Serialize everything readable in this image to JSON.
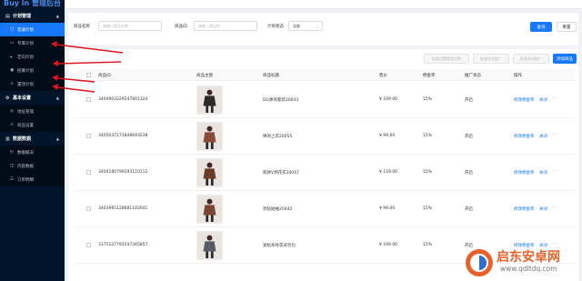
{
  "app": {
    "logo_text": "Buy in 管理后台"
  },
  "sidebar": {
    "groups": [
      {
        "label": "计划管理",
        "items": [
          {
            "label": "普通计划"
          },
          {
            "label": "专属计划"
          },
          {
            "label": "定向计划"
          },
          {
            "label": "招募计划"
          },
          {
            "label": "置顶计划"
          }
        ]
      },
      {
        "label": "基本设置",
        "items": [
          {
            "label": "地址管理"
          },
          {
            "label": "商品设置"
          }
        ]
      },
      {
        "label": "数据数据",
        "items": [
          {
            "label": "数据概况"
          },
          {
            "label": "内容数据"
          },
          {
            "label": "订单明细"
          }
        ]
      }
    ]
  },
  "filters": {
    "name_label": "商品名称",
    "name_placeholder": "请输入商品名称",
    "id_label": "商品ID",
    "id_placeholder": "请输入商品ID",
    "status_label": "计划状态",
    "status_value": "全部",
    "search_button": "查询",
    "reset_button": "重置"
  },
  "toolbar": {
    "batch_commission": "批量设置佣金比例",
    "batch_open": "批量开启推广",
    "batch_close": "批量关闭推广",
    "add_product": "添加商品"
  },
  "table": {
    "headers": [
      "商品ID",
      "商品主图",
      "商品标题",
      "售价",
      "佣金率",
      "推广状态",
      "操作"
    ],
    "rows": [
      {
        "id": "3404903329247801324",
        "title": "DG休闲套装20043",
        "price": "¥ 109.00",
        "rate": "15%",
        "status": "开启",
        "op1": "修改佣金率",
        "op2": "关闭",
        "more": "···",
        "thumb_color": "#2b2b2b"
      },
      {
        "id": "3405037271848693238",
        "title": "休闲上衣20055",
        "price": "¥ 99.00",
        "rate": "15%",
        "status": "开启",
        "op1": "修改佣金率",
        "op2": "关闭",
        "more": "···",
        "thumb_color": "#8a4a3a"
      },
      {
        "id": "3404180799293110112",
        "title": "新款V领花衣20047",
        "price": "¥ 119.00",
        "rate": "15%",
        "status": "开启",
        "op1": "修改佣金率",
        "op2": "关闭",
        "more": "···",
        "thumb_color": "#6b3a2b"
      },
      {
        "id": "3403965128681102041",
        "title": "亮钻短袖20042",
        "price": "¥ 99.00",
        "rate": "15%",
        "status": "开启",
        "op1": "修改佣金率",
        "op2": "关闭",
        "more": "···",
        "thumb_color": "#7a4636"
      },
      {
        "id": "3375127793547365857",
        "title": "宽松条纹花背包包",
        "price": "¥ 109.00",
        "rate": "15%",
        "status": "开启",
        "op1": "修改佣金率",
        "op2": "关闭",
        "more": "···",
        "thumb_color": "#5a5a66"
      }
    ]
  },
  "watermark": {
    "brand": "启东安卓网",
    "url": "www.qdltdq.com",
    "colors": {
      "orange": "#e8612a",
      "blue": "#2f6fd1"
    }
  },
  "colors": {
    "accent": "#1677ff",
    "sidebar": "#001529",
    "arrow": "#e0141e"
  }
}
